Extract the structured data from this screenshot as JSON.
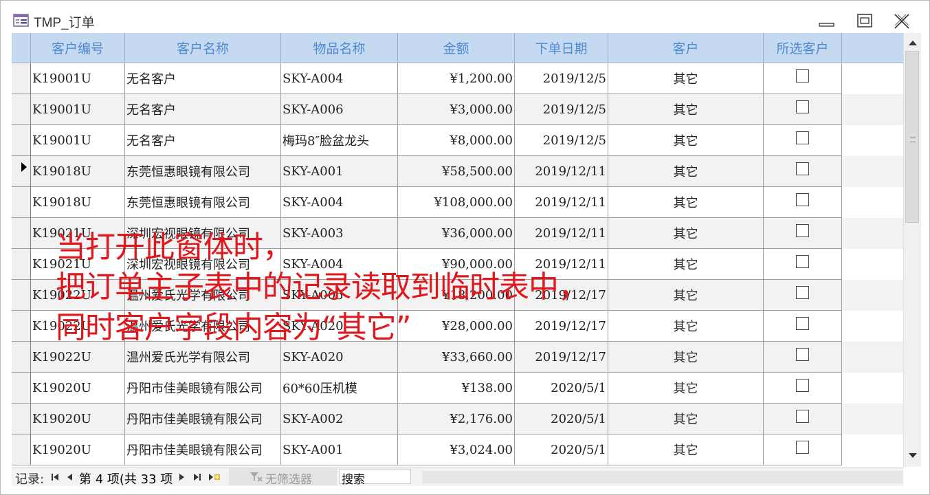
{
  "window": {
    "title": "TMP_订单",
    "icon": "form-icon"
  },
  "columns": [
    "客户编号",
    "客户名称",
    "物品名称",
    "金额",
    "下单日期",
    "客户",
    "所选客户"
  ],
  "rows": [
    {
      "id": "K19001U",
      "name": "无名客户",
      "item": "SKY-A004",
      "amount": "¥1,200.00",
      "date": "2019/12/5",
      "customer": "其它",
      "selected": false
    },
    {
      "id": "K19001U",
      "name": "无名客户",
      "item": "SKY-A006",
      "amount": "¥3,000.00",
      "date": "2019/12/5",
      "customer": "其它",
      "selected": false
    },
    {
      "id": "K19001U",
      "name": "无名客户",
      "item": "梅玛8″脸盆龙头",
      "amount": "¥8,000.00",
      "date": "2019/12/5",
      "customer": "其它",
      "selected": false
    },
    {
      "id": "K19018U",
      "name": "东莞恒惠眼镜有限公司",
      "item": "SKY-A001",
      "amount": "¥58,500.00",
      "date": "2019/12/11",
      "customer": "其它",
      "selected": false
    },
    {
      "id": "K19018U",
      "name": "东莞恒惠眼镜有限公司",
      "item": "SKY-A004",
      "amount": "¥108,000.00",
      "date": "2019/12/11",
      "customer": "其它",
      "selected": false
    },
    {
      "id": "K19021U",
      "name": "深圳宏视眼镜有限公司",
      "item": "SKY-A003",
      "amount": "¥36,000.00",
      "date": "2019/12/11",
      "customer": "其它",
      "selected": false
    },
    {
      "id": "K19021U",
      "name": "深圳宏视眼镜有限公司",
      "item": "SKY-A004",
      "amount": "¥90,000.00",
      "date": "2019/12/11",
      "customer": "其它",
      "selected": false
    },
    {
      "id": "K19022U",
      "name": "温州爱氏光学有限公司",
      "item": "SKY-A005",
      "amount": "¥18,200.00",
      "date": "2019/12/17",
      "customer": "其它",
      "selected": false
    },
    {
      "id": "K19022U",
      "name": "温州爱氏光学有限公司",
      "item": "SKY-A020",
      "amount": "¥28,000.00",
      "date": "2019/12/17",
      "customer": "其它",
      "selected": false
    },
    {
      "id": "K19022U",
      "name": "温州爱氏光学有限公司",
      "item": "SKY-A020",
      "amount": "¥33,660.00",
      "date": "2019/12/17",
      "customer": "其它",
      "selected": false
    },
    {
      "id": "K19020U",
      "name": "丹阳市佳美眼镜有限公司",
      "item": "60*60压机模",
      "amount": "¥138.00",
      "date": "2020/5/1",
      "customer": "其它",
      "selected": false
    },
    {
      "id": "K19020U",
      "name": "丹阳市佳美眼镜有限公司",
      "item": "SKY-A002",
      "amount": "¥2,176.00",
      "date": "2020/5/1",
      "customer": "其它",
      "selected": false
    },
    {
      "id": "K19020U",
      "name": "丹阳市佳美眼镜有限公司",
      "item": "SKY-A001",
      "amount": "¥3,024.00",
      "date": "2020/5/1",
      "customer": "其它",
      "selected": false
    }
  ],
  "current_row_index": 3,
  "navigation": {
    "record_label": "记录:",
    "position_text": "第 4 项(共 33 项",
    "filter_label": "无筛选器",
    "search_value": "搜索"
  },
  "overlay": {
    "line1": "当打开此窗体时，",
    "line2": "把订单主子表中的记录读取到临时表中，",
    "line3": "同时客户字段内容为“其它”",
    "color": "#e0181d"
  }
}
